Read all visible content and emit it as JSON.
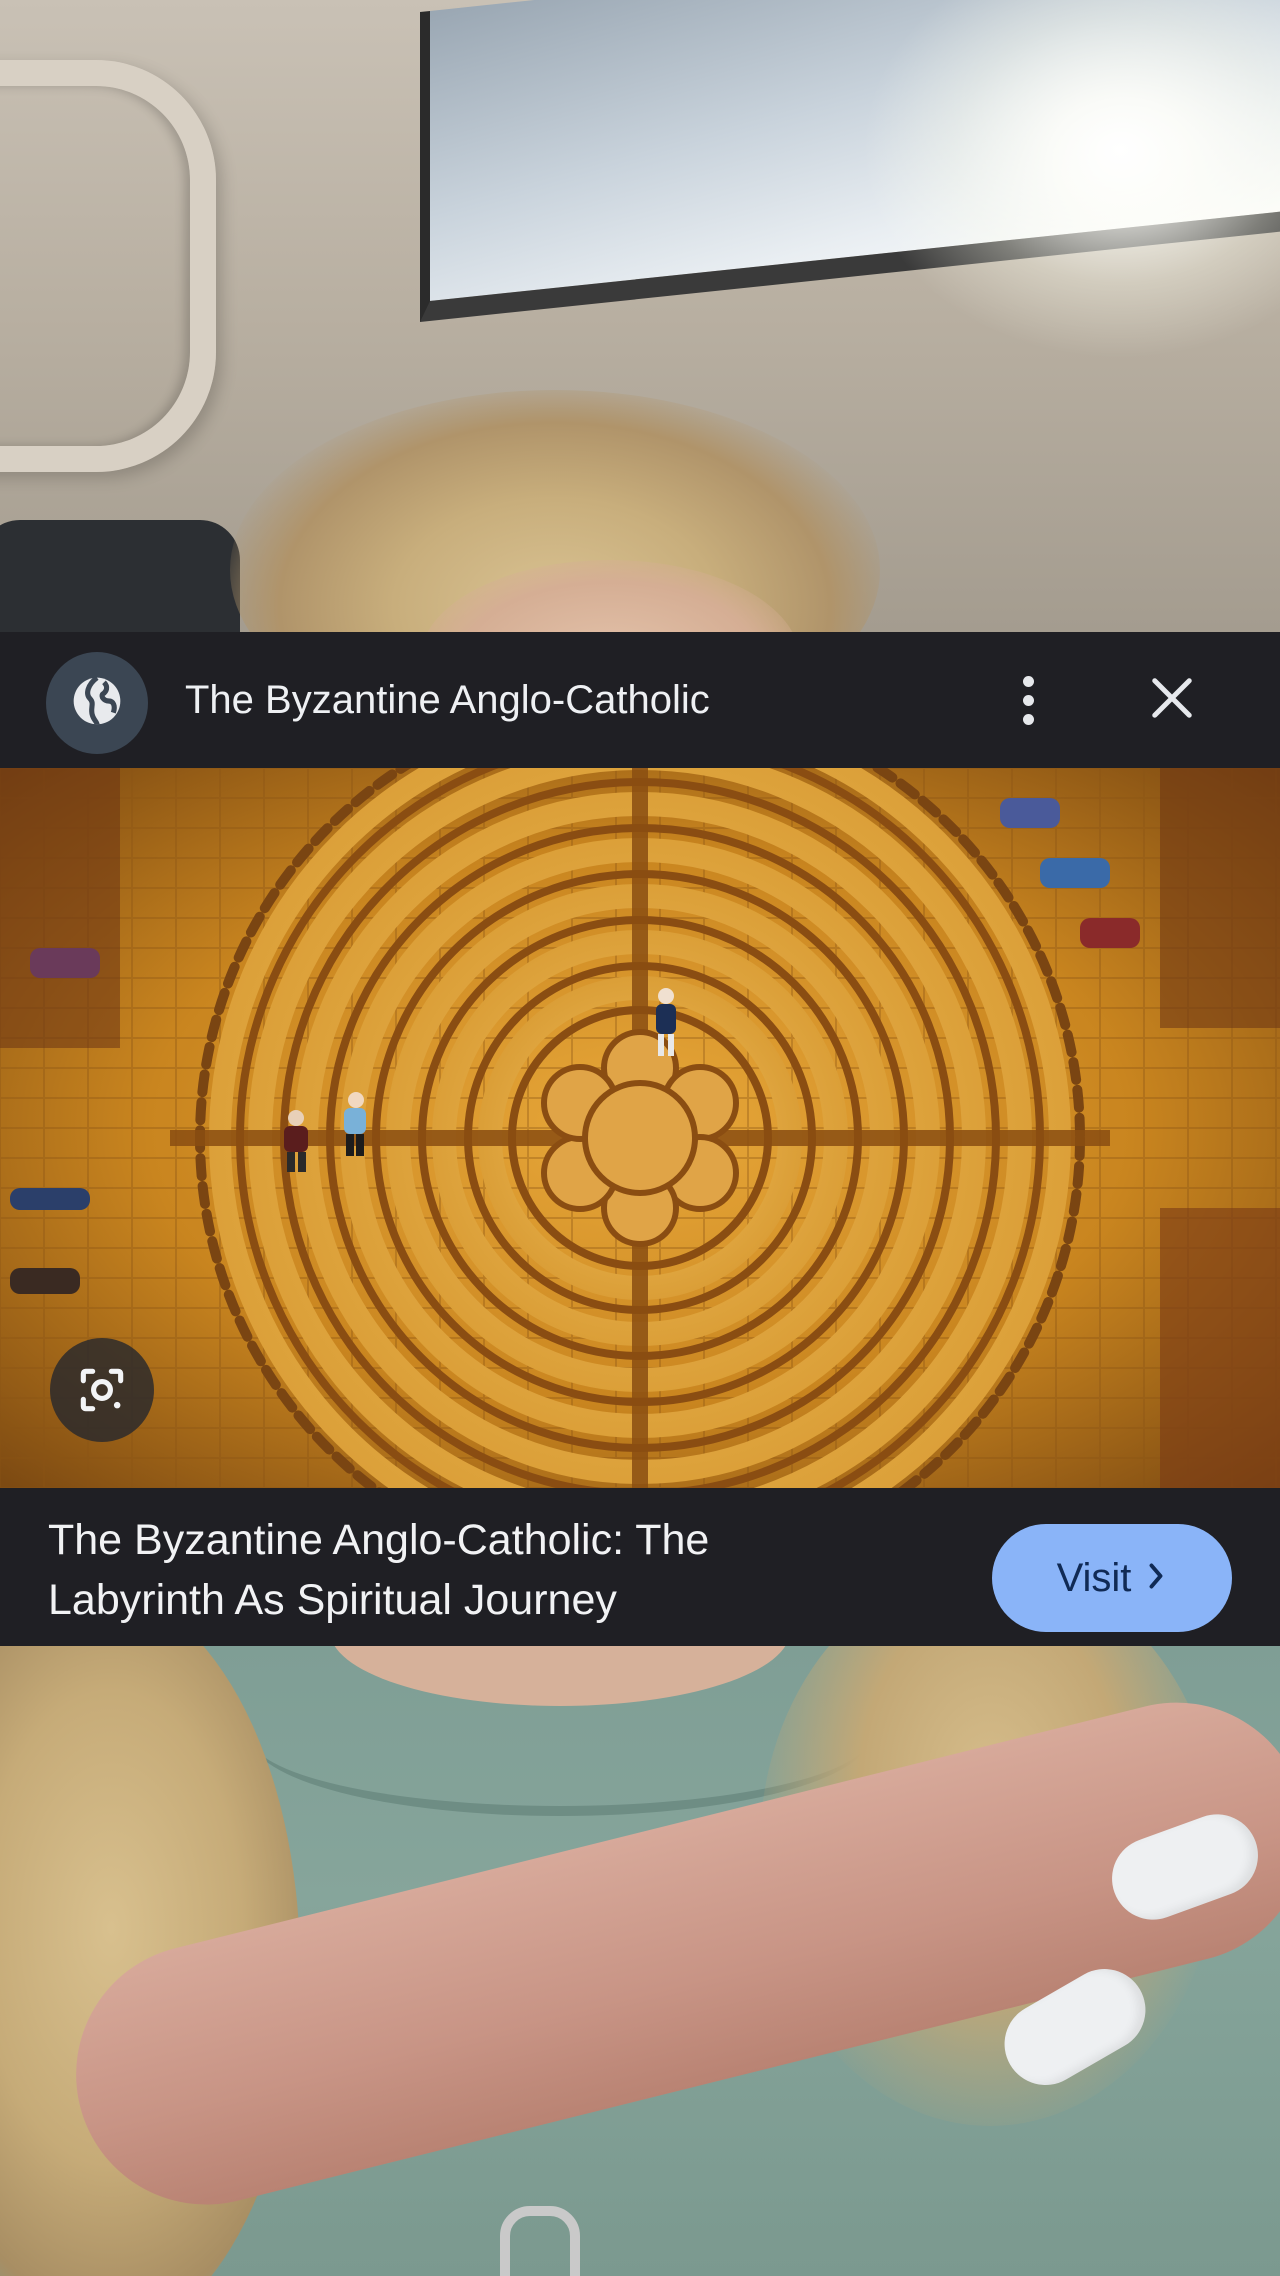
{
  "header": {
    "site_title": "The Byzantine Anglo-Catholic",
    "globe_icon": "globe-icon",
    "more_icon": "more-vert-icon",
    "close_icon": "close-icon"
  },
  "hero": {
    "image_subject": "labyrinth",
    "lens_icon": "image-search-icon"
  },
  "caption": {
    "title": "The Byzantine Anglo-Catholic: The Labyrinth As Spiritual Journey",
    "visit_label": "Visit",
    "visit_icon": "chevron-right-icon"
  },
  "colors": {
    "bar_background": "#1f1f24",
    "visit_button": "#8ab4f8",
    "visit_text": "#102a55",
    "globe_circle": "#3b4653"
  }
}
